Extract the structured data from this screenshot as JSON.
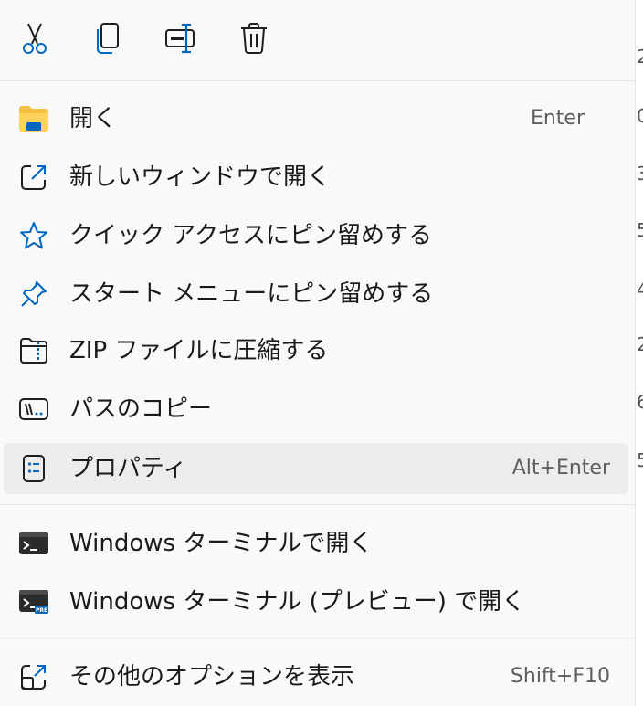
{
  "toolbar": {
    "buttons": [
      {
        "name": "cut",
        "icon": "scissors-icon"
      },
      {
        "name": "copy",
        "icon": "copy-icon"
      },
      {
        "name": "rename",
        "icon": "rename-icon"
      },
      {
        "name": "delete",
        "icon": "trash-icon"
      }
    ]
  },
  "menu": {
    "open": {
      "label": "開く",
      "shortcut": "Enter"
    },
    "open_new_window": {
      "label": "新しいウィンドウで開く"
    },
    "pin_quick_access": {
      "label": "クイック アクセスにピン留めする"
    },
    "pin_start": {
      "label": "スタート メニューにピン留めする"
    },
    "zip": {
      "label": "ZIP ファイルに圧縮する"
    },
    "copy_path": {
      "label": "パスのコピー"
    },
    "properties": {
      "label": "プロパティ",
      "shortcut": "Alt+Enter"
    },
    "terminal": {
      "label": "Windows ターミナルで開く"
    },
    "terminal_preview": {
      "label": "Windows ターミナル (プレビュー) で開く"
    },
    "more_options": {
      "label": "その他のオプションを表示",
      "shortcut": "Shift+F10"
    }
  },
  "background_column": [
    "2",
    "0",
    "3",
    "5",
    "4",
    "2",
    "6",
    "5"
  ],
  "colors": {
    "accent": "#0067c0",
    "folder_yellow": "#f4c142",
    "text": "#1a1a1a",
    "shortcut_text": "#5e5e5e",
    "menu_bg": "#f9f9f9",
    "hover_bg": "#ececec"
  }
}
